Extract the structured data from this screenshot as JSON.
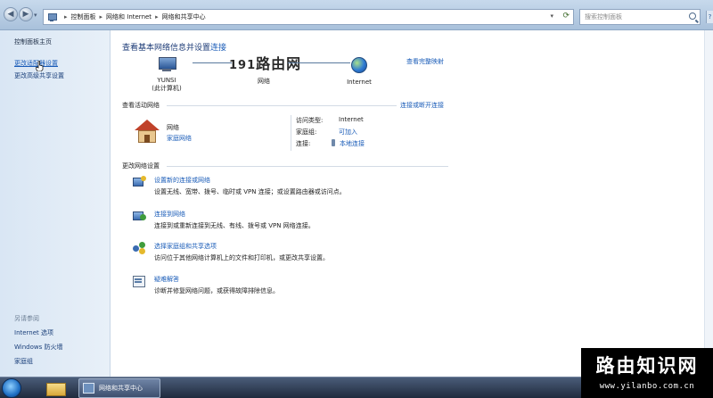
{
  "addressbar": {
    "breadcrumbs": [
      "控制面板",
      "网络和 Internet",
      "网络和共享中心"
    ],
    "search_placeholder": "搜索控制面板"
  },
  "leftpane": {
    "home": "控制面板主页",
    "links": [
      "更改适配器设置",
      "更改高级共享设置"
    ],
    "see_also": "另请参阅",
    "see_also_links": [
      "Internet 选项",
      "Windows 防火墙",
      "家庭组"
    ]
  },
  "main": {
    "title": "查看基本网络信息并设置",
    "title_link": "连接",
    "full_map": "查看完整映射",
    "nodes": {
      "computer_name": "YUNSI",
      "computer_sub": "(此计算机)",
      "network": "网络",
      "internet": "Internet"
    },
    "active_networks": {
      "heading": "查看活动网络",
      "connect_link": "连接或断开连接",
      "network_name": "网络",
      "network_type": "家庭网络",
      "access_type_label": "访问类型:",
      "access_type_value": "Internet",
      "homegroup_label": "家庭组:",
      "homegroup_value": "可加入",
      "connections_label": "连接:",
      "connections_value": "本地连接"
    },
    "change_settings": {
      "heading": "更改网络设置",
      "tasks": [
        {
          "title": "设置新的连接或网络",
          "desc": "设置无线、宽带、拨号、临时或 VPN 连接；或设置路由器或访问点。"
        },
        {
          "title": "连接到网络",
          "desc": "连接到或重新连接到无线、有线、拨号或 VPN 网络连接。"
        },
        {
          "title": "选择家庭组和共享选项",
          "desc": "访问位于其他网络计算机上的文件和打印机，或更改共享设置。"
        },
        {
          "title": "疑难解答",
          "desc": "诊断并修复网络问题，或获得故障排除信息。"
        }
      ]
    }
  },
  "watermarks": {
    "center_digits": "191",
    "center_text": "路由网",
    "corner_title": "路由知识网",
    "corner_url": "www.yilanbo.com.cn"
  },
  "taskbar": {
    "active_task": "网络和共享中心"
  }
}
